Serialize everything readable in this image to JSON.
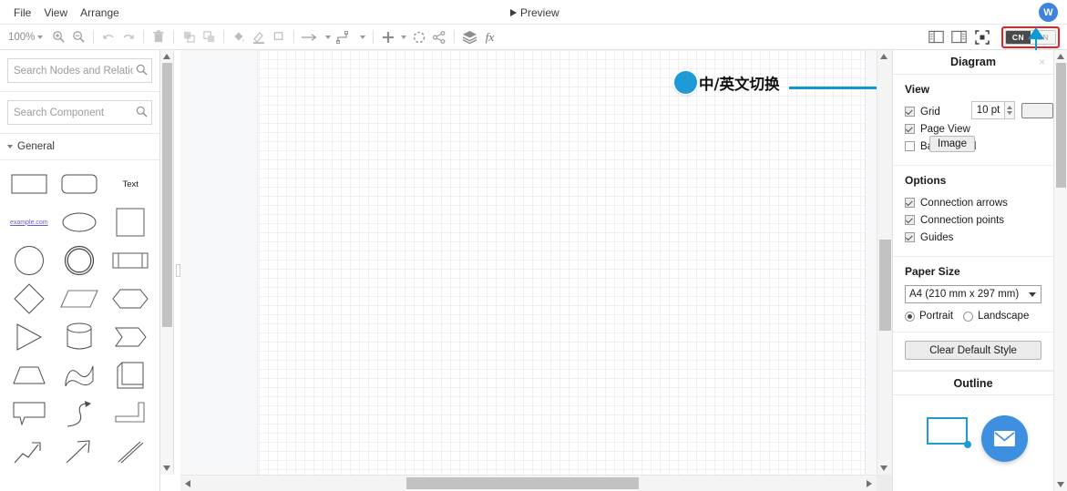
{
  "menubar": {
    "items": [
      {
        "label": "File"
      },
      {
        "label": "View"
      },
      {
        "label": "Arrange"
      }
    ],
    "preview_label": "Preview",
    "avatar_initial": "W"
  },
  "toolbar": {
    "zoom_level": "100%",
    "buttons": [
      {
        "name": "zoom-in-icon"
      },
      {
        "name": "zoom-out-icon"
      },
      {
        "name": "undo-icon"
      },
      {
        "name": "redo-icon"
      },
      {
        "name": "delete-icon"
      },
      {
        "name": "to-front-icon"
      },
      {
        "name": "to-back-icon"
      },
      {
        "name": "fill-color-icon"
      },
      {
        "name": "line-color-icon"
      },
      {
        "name": "shadow-icon"
      },
      {
        "name": "connection-icon"
      },
      {
        "name": "waypoints-icon"
      },
      {
        "name": "insert-icon"
      },
      {
        "name": "table-icon"
      },
      {
        "name": "share-icon"
      },
      {
        "name": "layers-icon"
      },
      {
        "name": "formula-icon"
      }
    ],
    "right_buttons": [
      {
        "name": "format-panel-icon"
      },
      {
        "name": "outline-panel-icon"
      },
      {
        "name": "fullscreen-icon"
      }
    ],
    "language_toggle": {
      "selected": "CN",
      "options": [
        "CN",
        "EN"
      ],
      "highlight_color": "#ee1c25"
    }
  },
  "left_panel": {
    "search_nodes": {
      "placeholder": "Search Nodes and Relations",
      "value": ""
    },
    "search_component": {
      "placeholder": "Search Component",
      "value": ""
    },
    "section": {
      "label": "General",
      "expanded": true
    },
    "shapes": [
      {
        "name": "rectangle",
        "label": ""
      },
      {
        "name": "rounded-rectangle",
        "label": ""
      },
      {
        "name": "text-shape",
        "label": "Text"
      },
      {
        "name": "link-shape",
        "label": "example.com"
      },
      {
        "name": "ellipse",
        "label": ""
      },
      {
        "name": "square",
        "label": ""
      },
      {
        "name": "circle",
        "label": ""
      },
      {
        "name": "double-circle",
        "label": ""
      },
      {
        "name": "process",
        "label": ""
      },
      {
        "name": "diamond",
        "label": ""
      },
      {
        "name": "parallelogram",
        "label": ""
      },
      {
        "name": "hexagon",
        "label": ""
      },
      {
        "name": "triangle",
        "label": ""
      },
      {
        "name": "cylinder",
        "label": ""
      },
      {
        "name": "arrow-block",
        "label": ""
      },
      {
        "name": "trapezoid",
        "label": ""
      },
      {
        "name": "wave",
        "label": ""
      },
      {
        "name": "document",
        "label": ""
      },
      {
        "name": "callout",
        "label": ""
      },
      {
        "name": "curved-arrow",
        "label": ""
      },
      {
        "name": "corner",
        "label": ""
      },
      {
        "name": "double-arrow-up",
        "label": ""
      },
      {
        "name": "arrow-up-right",
        "label": ""
      },
      {
        "name": "double-line",
        "label": ""
      }
    ]
  },
  "canvas": {
    "annotation": {
      "text": "中/英文切换",
      "dot_color": "#1e9bd7",
      "line_color": "#0d98d8"
    }
  },
  "right_panel": {
    "title": "Diagram",
    "close_label": "×",
    "view": {
      "title": "View",
      "grid": {
        "label": "Grid",
        "checked": true,
        "size_value": "10 pt"
      },
      "page_view": {
        "label": "Page View",
        "checked": true
      },
      "background": {
        "label": "Background",
        "checked": false,
        "image_button": "Image"
      }
    },
    "options": {
      "title": "Options",
      "items": [
        {
          "label": "Connection arrows",
          "checked": true
        },
        {
          "label": "Connection points",
          "checked": true
        },
        {
          "label": "Guides",
          "checked": true
        }
      ]
    },
    "paper_size": {
      "title": "Paper Size",
      "selected": "A4 (210 mm x 297 mm)",
      "orientation": [
        {
          "label": "Portrait",
          "selected": true
        },
        {
          "label": "Landscape",
          "selected": false
        }
      ]
    },
    "clear_default_style": "Clear Default Style",
    "outline": {
      "title": "Outline",
      "shape_color": "#1e9bd7",
      "fab_color": "#3d8fe0",
      "fab_icon": "mail-icon"
    }
  }
}
